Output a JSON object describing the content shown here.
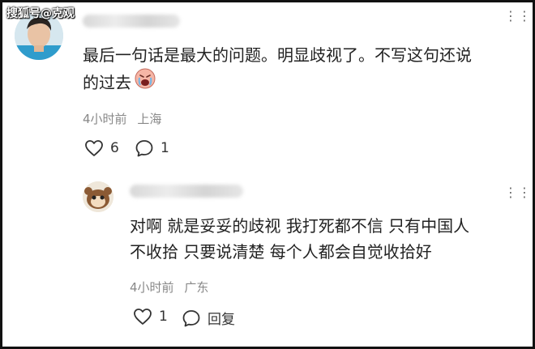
{
  "watermark": "搜狐号@克观",
  "comment": {
    "text_line1": "最后一句话是最大的问题。明显歧视了。不写这句还说",
    "text_line2": "的过去",
    "emoji_icon": "crying-face-icon",
    "time": "4小时前",
    "location": "上海",
    "like_count": "6",
    "reply_count": "1"
  },
  "reply": {
    "text_line1": "对啊 就是妥妥的歧视 我打死都不信 只有中国人",
    "text_line2": "不收拾 只要说清楚 每个人都会自觉收拾好",
    "time": "4小时前",
    "location": "广东",
    "like_count": "1",
    "reply_label": "回复"
  },
  "colors": {
    "text": "#222222",
    "meta": "#888888",
    "border": "#111111"
  }
}
